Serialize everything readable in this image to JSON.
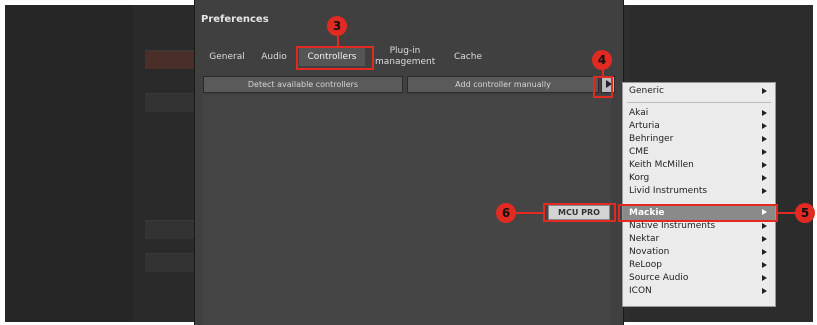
{
  "dialog": {
    "title": "Preferences",
    "tabs": [
      {
        "label": "General"
      },
      {
        "label": "Audio"
      },
      {
        "label": "Controllers"
      },
      {
        "label": "Plug-in\nmanagement"
      },
      {
        "label": "Cache"
      }
    ],
    "buttons": {
      "detect": "Detect available controllers",
      "add": "Add controller manually"
    }
  },
  "menu": {
    "items": [
      {
        "label": "Generic"
      },
      {
        "label": "Akai"
      },
      {
        "label": "Arturia"
      },
      {
        "label": "Behringer"
      },
      {
        "label": "CME"
      },
      {
        "label": "Keith McMillen"
      },
      {
        "label": "Korg"
      },
      {
        "label": "Livid Instruments"
      },
      {
        "label": "Mackie"
      },
      {
        "label": "Native Instruments"
      },
      {
        "label": "Nektar"
      },
      {
        "label": "Novation"
      },
      {
        "label": "ReLoop"
      },
      {
        "label": "Source Audio"
      },
      {
        "label": "ICON"
      }
    ]
  },
  "submenu": {
    "label": "MCU PRO"
  },
  "callouts": [
    "3",
    "4",
    "5",
    "6"
  ],
  "colors": {
    "accent": "#e02a22",
    "menu_highlight": "#8a8a8a"
  }
}
